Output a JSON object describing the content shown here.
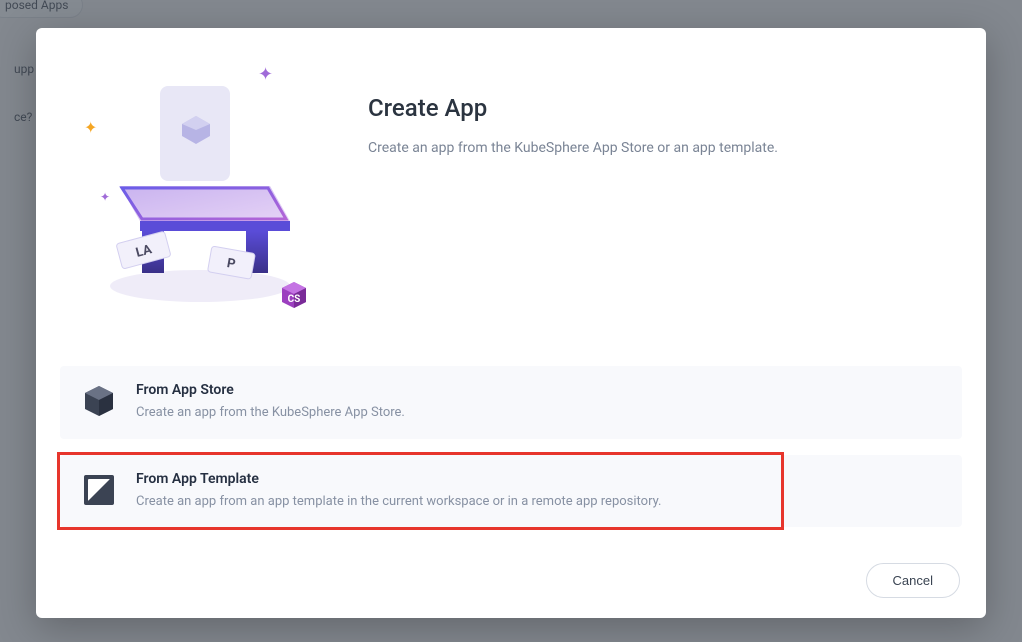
{
  "background": {
    "tab_label": "posed Apps",
    "row1": "upp",
    "row2": "ce?"
  },
  "modal": {
    "title": "Create App",
    "subtitle": "Create an app from the KubeSphere App Store or an app template.",
    "options": [
      {
        "title": "From App Store",
        "desc": "Create an app from the KubeSphere App Store."
      },
      {
        "title": "From App Template",
        "desc": "Create an app from an app template in the current workspace or in a remote app repository."
      }
    ],
    "cancel_label": "Cancel"
  }
}
